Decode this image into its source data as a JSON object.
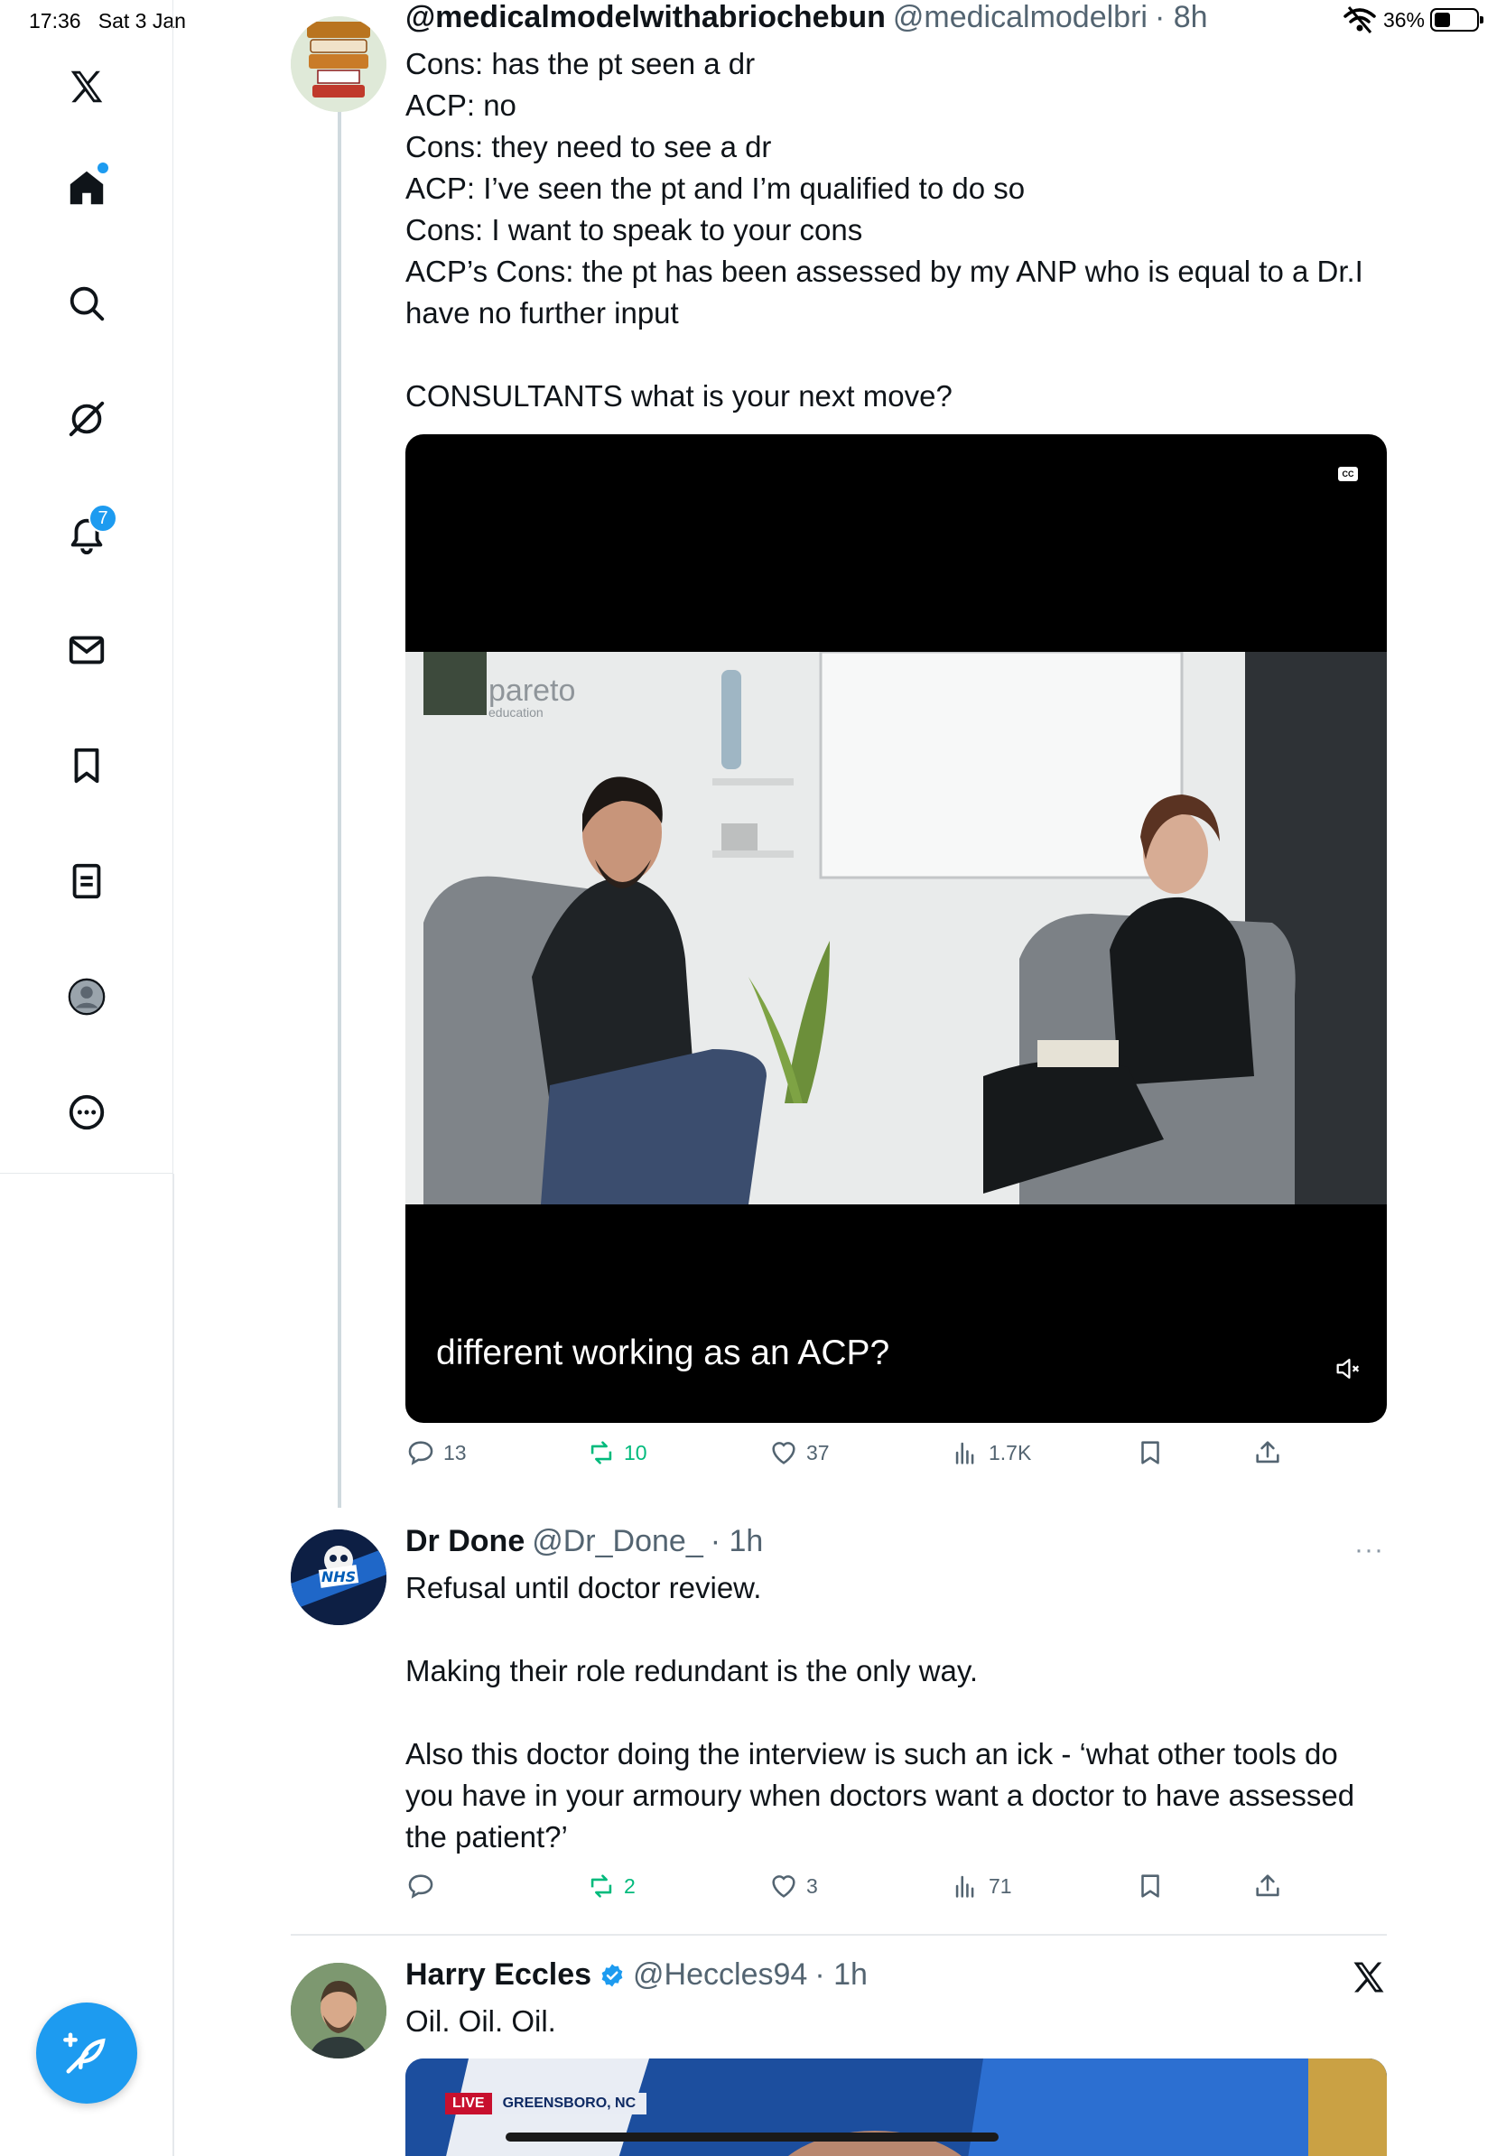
{
  "status_bar": {
    "time": "17:36",
    "date": "Sat 3 Jan",
    "battery": "36%",
    "battery_level": 0.36
  },
  "sidebar": {
    "items": [
      {
        "name": "logo",
        "icon": "x-logo-icon"
      },
      {
        "name": "home",
        "icon": "home-icon"
      },
      {
        "name": "explore",
        "icon": "search-icon"
      },
      {
        "name": "grok",
        "icon": "grok-icon"
      },
      {
        "name": "notifications",
        "icon": "bell-icon",
        "badge": "7"
      },
      {
        "name": "messages",
        "icon": "mail-icon"
      },
      {
        "name": "bookmarks",
        "icon": "bookmark-icon"
      },
      {
        "name": "lists",
        "icon": "list-icon"
      },
      {
        "name": "profile",
        "icon": "profile-icon"
      },
      {
        "name": "more",
        "icon": "more-icon"
      }
    ],
    "compose_icon": "compose-icon"
  },
  "tweets": [
    {
      "name": "@medicalmodelwithabriochebun",
      "handle": "@medicalmodelbri",
      "time": "· 8h",
      "text": "Cons: has the pt seen a dr\nACP: no\nCons: they need to see a dr\nACP: I’ve seen the pt and I’m qualified to do so\nCons: I want to speak to your cons\nACP’s Cons: the pt has been assessed by my ANP who is equal to a Dr.I have no further input\n\nCONSULTANTS what is your next move?",
      "avatar_text": [
        "General",
        "Medical",
        "Council",
        "NO",
        "TO",
        "PHYSICIAN"
      ],
      "video": {
        "caption": "different working as an ACP?",
        "watermark": "pareto",
        "watermark_sub": "education",
        "cc": "CC"
      },
      "stats": {
        "replies": "13",
        "reposts": "10",
        "likes": "37",
        "views": "1.7K"
      }
    },
    {
      "name": "Dr Done",
      "handle": "@Dr_Done_",
      "time": "· 1h",
      "text": "Refusal until doctor review.\n\nMaking their role redundant is the only way.\n\nAlso this doctor doing the interview is such an ick - ‘what other tools do you have in your armoury when doctors want a doctor to have assessed the patient?’",
      "avatar_text": "NHS",
      "stats": {
        "replies": "",
        "reposts": "2",
        "likes": "3",
        "views": "71"
      }
    },
    {
      "name": "Harry Eccles",
      "handle": "@Heccles94",
      "time": "· 1h",
      "text": "Oil. Oil. Oil.",
      "verified": true,
      "preview": {
        "live": "LIVE",
        "location": "GREENSBORO, NC"
      }
    }
  ]
}
